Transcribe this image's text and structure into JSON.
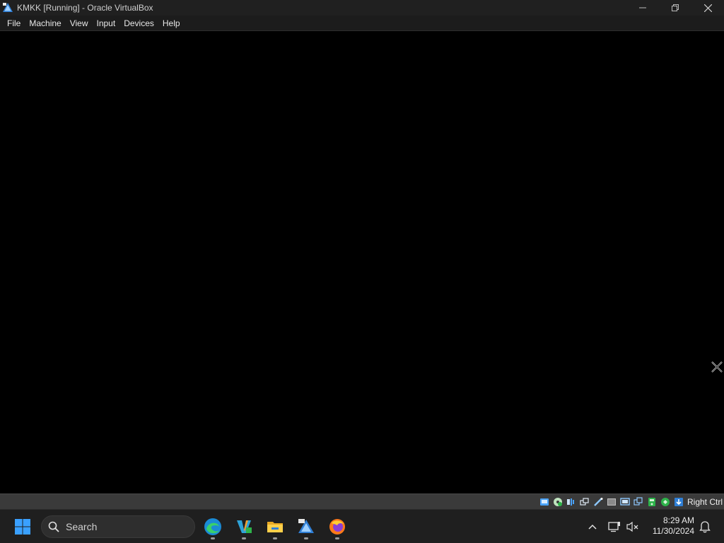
{
  "window": {
    "title": "KMKK [Running] - Oracle VirtualBox",
    "app_icon": "virtualbox-icon",
    "controls": [
      "minimize-icon",
      "restore-icon",
      "close-icon"
    ]
  },
  "menubar": {
    "items": [
      {
        "label": "File"
      },
      {
        "label": "Machine"
      },
      {
        "label": "View"
      },
      {
        "label": "Input"
      },
      {
        "label": "Devices"
      },
      {
        "label": "Help"
      }
    ]
  },
  "vm": {
    "screen_color": "#000000"
  },
  "statusbar": {
    "icons": [
      "hard-disk-icon",
      "optical-drive-icon",
      "audio-icon",
      "network-icon",
      "usb-icon",
      "shared-folders-icon",
      "display-icon",
      "recording-icon",
      "vrde-icon",
      "cpu-icon",
      "mouse-integration-icon",
      "keyboard-capture-icon"
    ],
    "host_key": "Right Ctrl"
  },
  "taskbar": {
    "search_label": "Search",
    "apps": [
      {
        "name": "edge-icon"
      },
      {
        "name": "visual-studio-icon"
      },
      {
        "name": "file-explorer-icon"
      },
      {
        "name": "virtualbox-icon"
      },
      {
        "name": "firefox-icon"
      }
    ],
    "clock": {
      "time": "8:29 AM",
      "date": "11/30/2024"
    }
  },
  "colors": {
    "titlebar": "#202020",
    "statusbar": "#3a3a3a",
    "taskbar": "#1f1f1f",
    "windows_blue": "#3aa0ff"
  }
}
